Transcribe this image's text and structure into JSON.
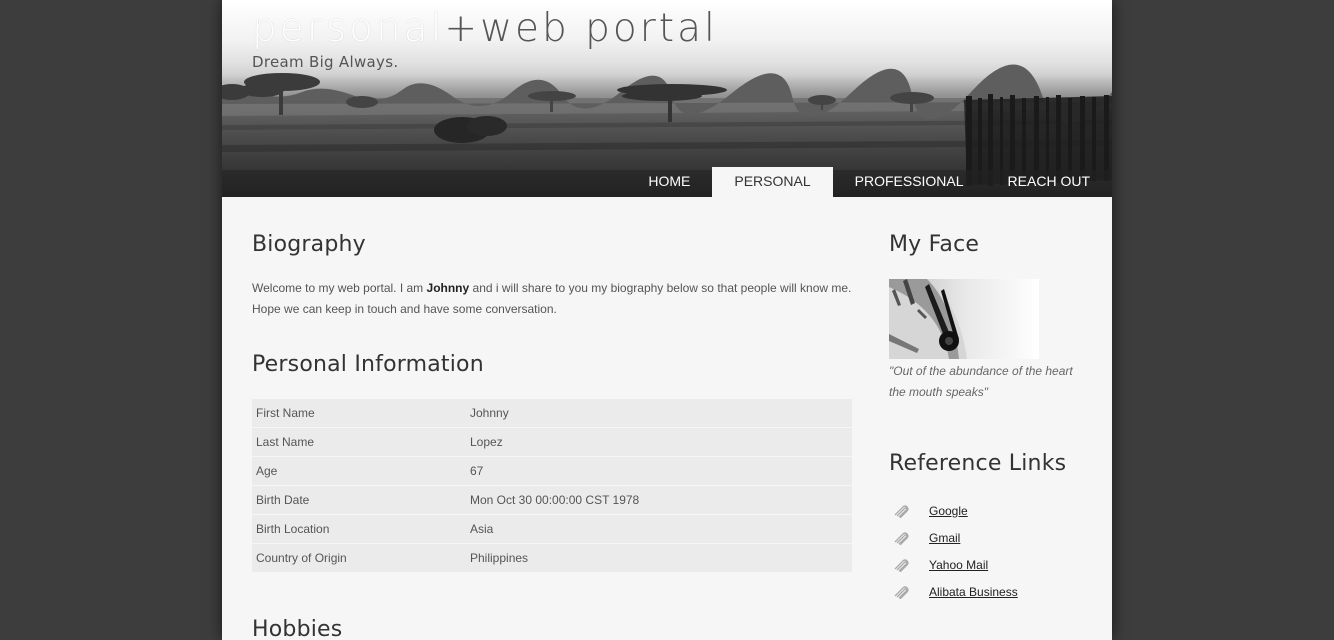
{
  "header": {
    "title_part1": "personal",
    "title_part2": "+web portal",
    "tagline": "Dream Big Always."
  },
  "nav": {
    "items": [
      {
        "label": "HOME"
      },
      {
        "label": "PERSONAL",
        "active": true
      },
      {
        "label": "PROFESSIONAL"
      },
      {
        "label": "REACH OUT"
      }
    ]
  },
  "biography": {
    "heading": "Biography",
    "text_before": "Welcome to my web portal. I am ",
    "name_bold": "Johnny",
    "text_after": " and i will share to you my biography below so that people will know me. Hope we can keep in touch and have some conversation."
  },
  "personal_info": {
    "heading": "Personal Information",
    "rows": [
      {
        "label": "First Name",
        "value": "Johnny"
      },
      {
        "label": "Last Name",
        "value": "Lopez"
      },
      {
        "label": "Age",
        "value": "67"
      },
      {
        "label": "Birth Date",
        "value": "Mon Oct 30 00:00:00 CST 1978"
      },
      {
        "label": "Birth Location",
        "value": "Asia"
      },
      {
        "label": "Country of Origin",
        "value": "Philippines"
      }
    ]
  },
  "hobbies": {
    "heading": "Hobbies"
  },
  "sidebar": {
    "face_heading": "My Face",
    "quote": "\"Out of the abundance of the heart the mouth speaks\"",
    "links_heading": "Reference Links",
    "links": [
      {
        "label": "Google"
      },
      {
        "label": "Gmail"
      },
      {
        "label": "Yahoo Mail"
      },
      {
        "label": "Alibata Business"
      }
    ]
  },
  "colors": {
    "background": "#3d3d3d",
    "page": "#f6f6f6",
    "row": "#ebebeb",
    "text": "#555555"
  }
}
